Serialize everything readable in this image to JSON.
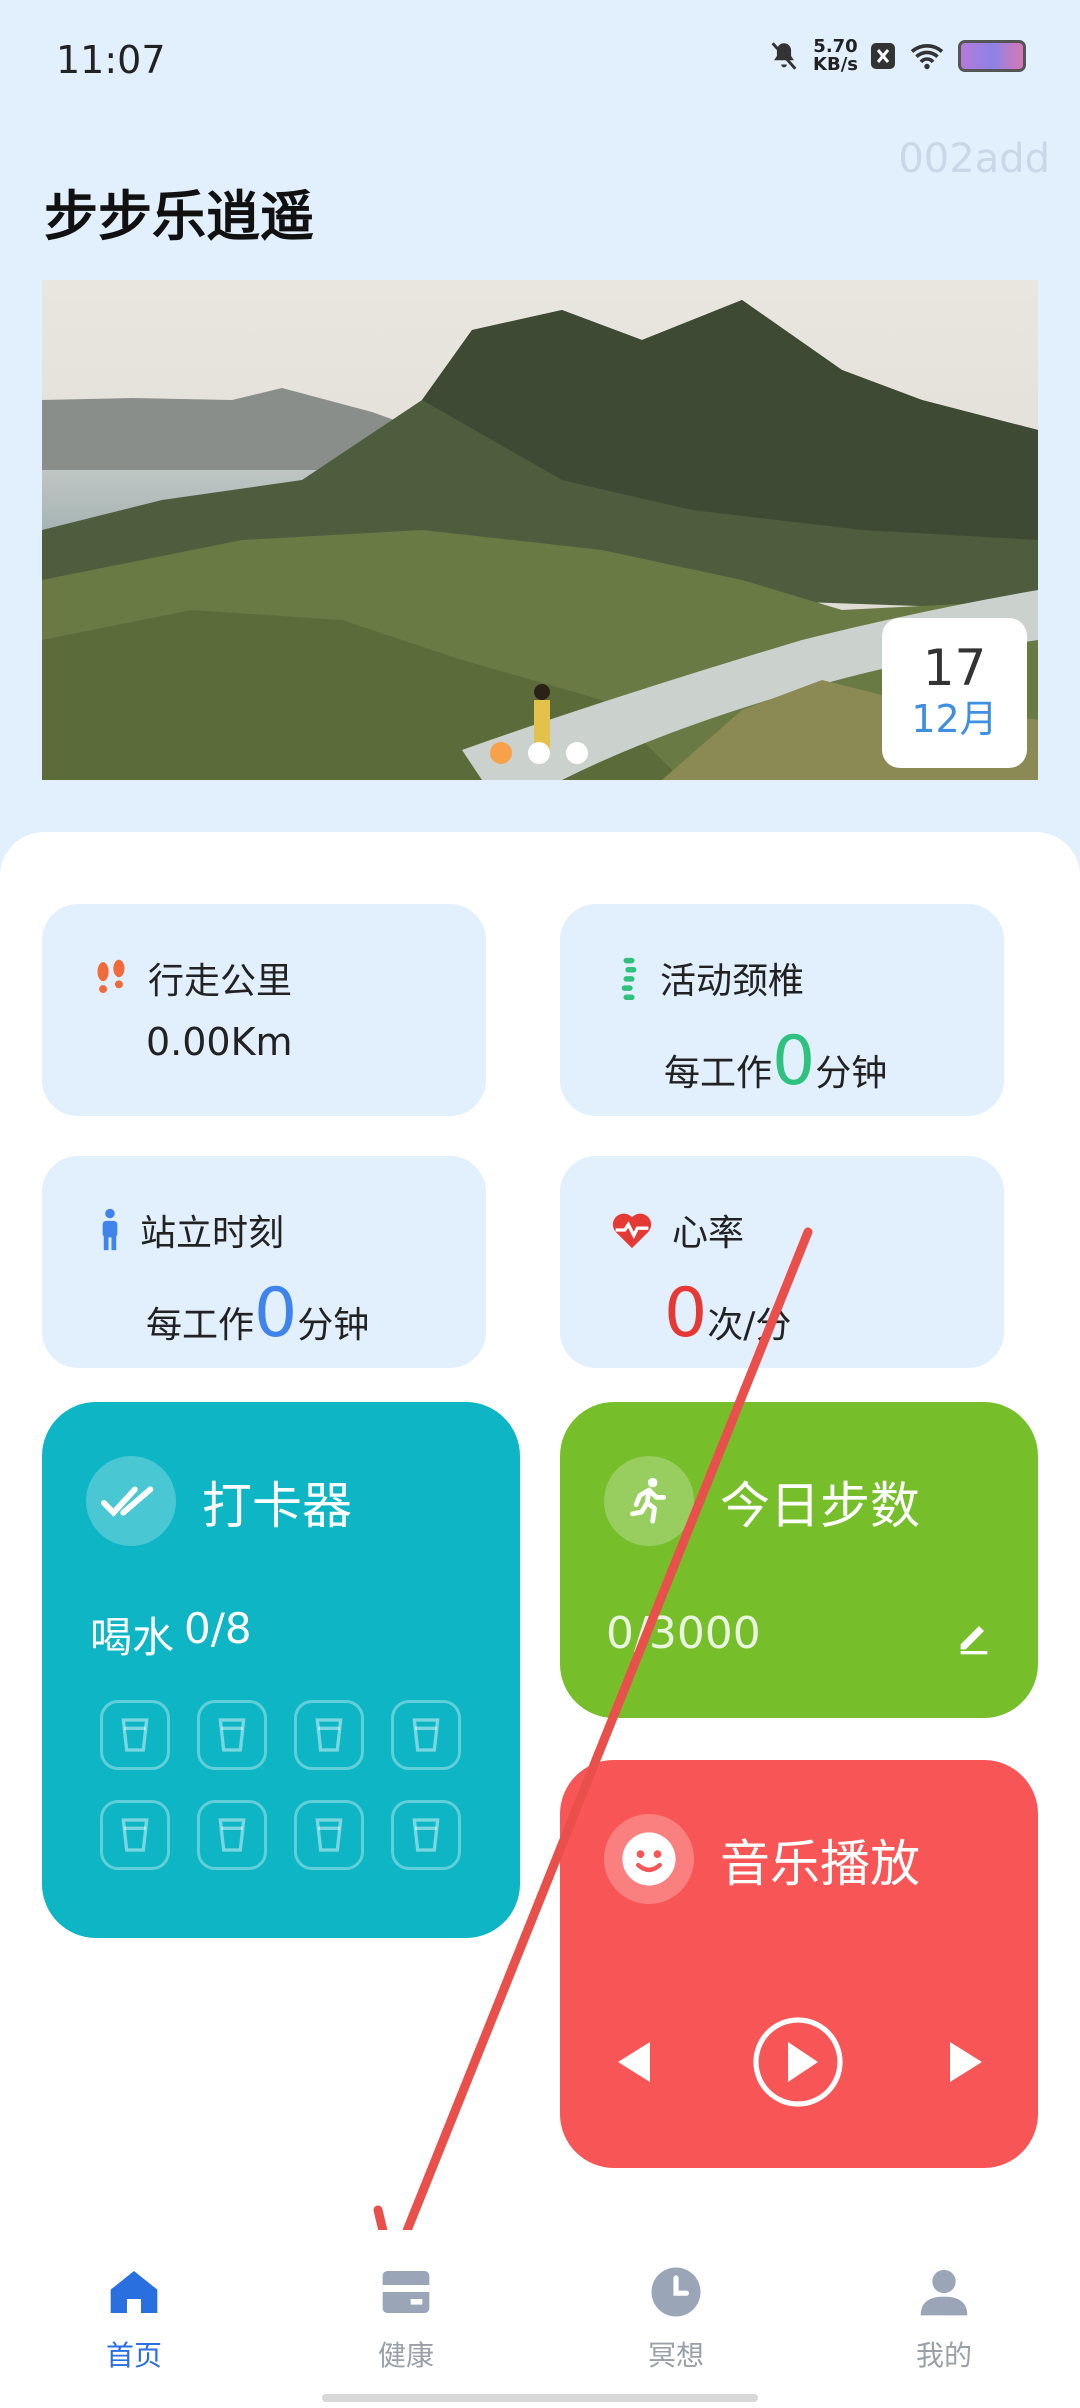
{
  "status_bar": {
    "time": "11:07",
    "net_speed_value": "5.70",
    "net_speed_unit": "KB/s"
  },
  "watermark": "002add",
  "app_title": "步步乐逍遥",
  "banner": {
    "date_day": "17",
    "date_month": "12月"
  },
  "stats": {
    "walk": {
      "title": "行走公里",
      "value": "0.00Km"
    },
    "neck": {
      "title": "活动颈椎",
      "prefix": "每工作",
      "value": "0",
      "suffix": "分钟"
    },
    "stand": {
      "title": "站立时刻",
      "prefix": "每工作",
      "value": "0",
      "suffix": "分钟"
    },
    "heart": {
      "title": "心率",
      "value": "0",
      "suffix": "次/分"
    }
  },
  "checkin": {
    "title": "打卡器",
    "water_label": "喝水",
    "water_count": "0/8",
    "cups": 8
  },
  "steps": {
    "title": "今日步数",
    "value": "0/3000"
  },
  "music": {
    "title": "音乐播放"
  },
  "nav": {
    "items": [
      {
        "label": "首页",
        "icon": "home-icon"
      },
      {
        "label": "健康",
        "icon": "wallet-icon"
      },
      {
        "label": "冥想",
        "icon": "clock-icon"
      },
      {
        "label": "我的",
        "icon": "person-icon"
      }
    ]
  },
  "colors": {
    "accent": "#2a6fe0",
    "checkin_bg": "#0db5c5",
    "steps_bg": "#76be2a",
    "music_bg": "#f85656",
    "heart_red": "#e53935",
    "neck_green": "#2ec27e",
    "stand_blue": "#3f84ea"
  }
}
